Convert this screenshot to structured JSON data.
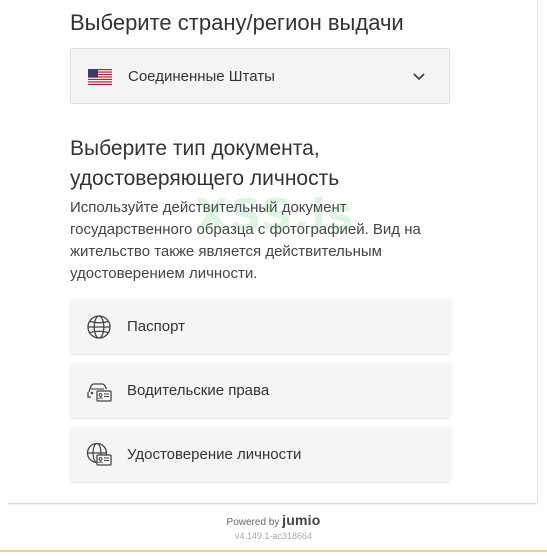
{
  "country_section": {
    "heading": "Выберите страну/регион выдачи",
    "selected_country": "Соединенные Штаты"
  },
  "document_section": {
    "heading": "Выберите тип документа, удостоверяющего личность",
    "description": "Используйте действительный документ государственного образца с фотографией. Вид на жительство также является действительным удостоверением личности.",
    "options": [
      {
        "label": "Паспорт",
        "icon": "globe-icon"
      },
      {
        "label": "Водительские права",
        "icon": "car-license-icon"
      },
      {
        "label": "Удостоверение личности",
        "icon": "id-card-icon"
      }
    ]
  },
  "footer": {
    "powered_by": "Powered by",
    "brand": "jumio",
    "version": "v4.149.1-ac318664"
  },
  "watermark": "XSS.is",
  "colors": {
    "card_bg": "#f5f5f5",
    "text": "#333333",
    "accent_line": "#e7d88a"
  }
}
